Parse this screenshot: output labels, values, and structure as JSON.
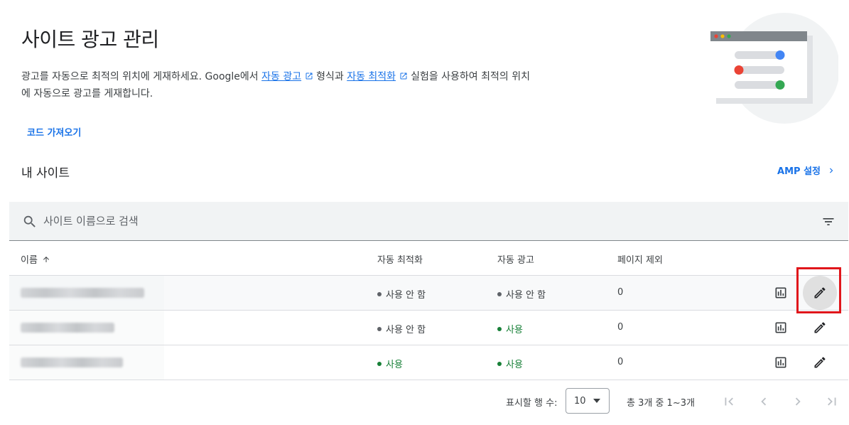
{
  "page": {
    "title": "사이트 광고 관리",
    "description": {
      "part1": "광고를 자동으로 최적의 위치에 게재하세요. Google에서 ",
      "link1": "자동 광고",
      "part2": "형식과 ",
      "link2": "자동 최적화",
      "part3": "실험을 사용하여 최적의 위치에 자동으로 광고를 게재합니다."
    },
    "get_code": "코드 가져오기"
  },
  "sites_section": {
    "heading": "내 사이트",
    "amp_link": "AMP 설정"
  },
  "search": {
    "placeholder": "사이트 이름으로 검색"
  },
  "table": {
    "columns": {
      "name": "이름",
      "auto_optimize": "자동 최적화",
      "auto_ads": "자동 광고",
      "page_exclusions": "페이지 제외"
    },
    "rows": [
      {
        "site": "",
        "auto_optimize": "사용 안 함",
        "auto_optimize_on": false,
        "auto_ads": "사용 안 함",
        "auto_ads_on": false,
        "page_exclusions": "0"
      },
      {
        "site": "",
        "auto_optimize": "사용 안 함",
        "auto_optimize_on": false,
        "auto_ads": "사용",
        "auto_ads_on": true,
        "page_exclusions": "0"
      },
      {
        "site": "",
        "auto_optimize": "사용",
        "auto_optimize_on": true,
        "auto_ads": "사용",
        "auto_ads_on": true,
        "page_exclusions": "0"
      }
    ]
  },
  "pagination": {
    "rows_label": "표시할 행 수:",
    "rows_value": "10",
    "range": "총 3개 중 1~3개"
  },
  "colors": {
    "accent": "#1a73e8",
    "enabled": "#188038",
    "disabled": "#5f6368",
    "highlight": "#e0161b"
  },
  "icons": [
    "search-icon",
    "filter-icon",
    "sort-arrow-up-icon",
    "external-link-icon",
    "chevron-right-icon",
    "report-icon",
    "edit-pencil-icon",
    "first-page-icon",
    "prev-page-icon",
    "next-page-icon",
    "last-page-icon",
    "dropdown-arrow-icon"
  ]
}
